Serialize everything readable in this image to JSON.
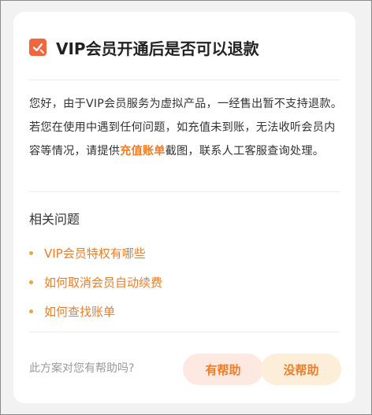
{
  "title": "VIP会员开通后是否可以退款",
  "answer": {
    "text_before": "您好，由于VIP会员服务为虚拟产品，一经售出暂不支持退款。若您在使用中遇到任何问题，如充值未到账，无法收听会员内容等情况，请提供",
    "highlight": "充值账单",
    "text_after": "截图，联系人工客服查询处理。"
  },
  "related": {
    "title": "相关问题",
    "items": [
      {
        "label": "VIP会员特权有哪些"
      },
      {
        "label": "如何取消会员自动续费"
      },
      {
        "label": "如何查找账单"
      }
    ]
  },
  "feedback": {
    "question": "此方案对您有帮助吗?",
    "yes_label": "有帮助",
    "no_label": "没帮助"
  },
  "colors": {
    "accent": "#f07d28",
    "icon_bg": "#f0663f",
    "yes_bg": "#fde9e2",
    "no_bg": "#fdeed9"
  },
  "icons": {
    "header": "checkbox-pencil-icon",
    "bullet": "dot-icon"
  }
}
